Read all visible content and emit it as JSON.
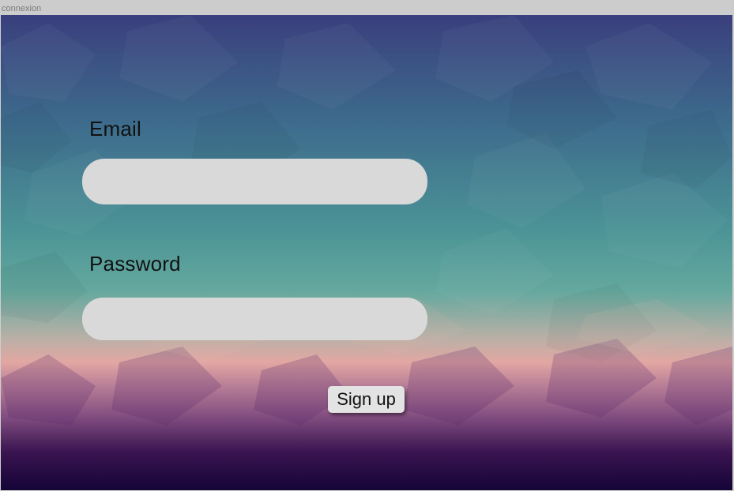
{
  "window": {
    "title": "connexion"
  },
  "form": {
    "email_label": "Email",
    "email_value": "",
    "password_label": "Password",
    "password_value": "",
    "signup_label": "Sign up"
  }
}
